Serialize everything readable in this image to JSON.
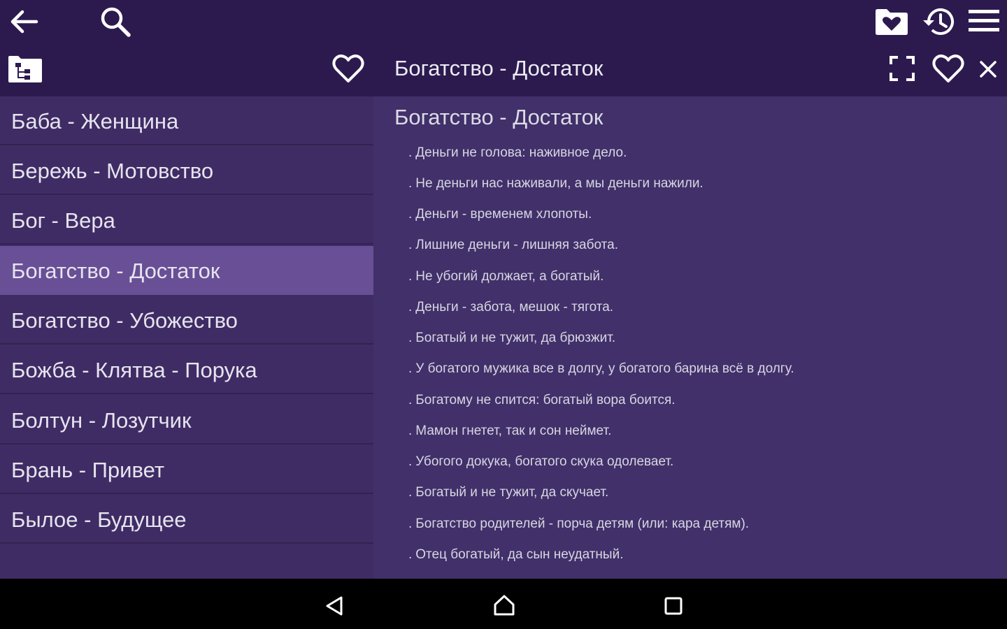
{
  "header": {
    "title": "Богатство - Достаток",
    "icons": [
      "back-arrow-icon",
      "search-icon",
      "heart-folder-icon",
      "history-icon",
      "menu-icon",
      "tree-icon",
      "heart-outline-icon",
      "fullscreen-icon",
      "close-icon"
    ]
  },
  "list": {
    "items": [
      {
        "label": "Баба - Женщина",
        "selected": false
      },
      {
        "label": "Бережь - Мотовство",
        "selected": false
      },
      {
        "label": "Бог - Вера",
        "selected": false
      },
      {
        "label": "Богатство - Достаток",
        "selected": true
      },
      {
        "label": "Богатство - Убожество",
        "selected": false
      },
      {
        "label": "Божба - Клятва - Порука",
        "selected": false
      },
      {
        "label": "Болтун - Лозутчик",
        "selected": false
      },
      {
        "label": "Брань - Привет",
        "selected": false
      },
      {
        "label": "Былое - Будущее",
        "selected": false
      }
    ]
  },
  "detail": {
    "heading": "Богатство - Достаток",
    "bullet": ".",
    "proverbs": [
      "Деньги не голова: наживное дело.",
      "Не деньги нас наживали, а мы деньги нажили.",
      "Деньги - временем хлопоты.",
      "Лишние деньги - лишняя забота.",
      "Не убогий должает, а богатый.",
      "Деньги - забота, мешок - тягота.",
      "Богатый и не тужит, да брюзжит.",
      "У богатого мужика все в долгу, у богатого барина всё в долгу.",
      "Богатому не спится: богатый вора боится.",
      "Мамон гнетет, так и сон неймет.",
      "Убогого докука, богатого скука одолевает.",
      "Богатый и не тужит, да скучает.",
      "Богатство родителей - порча детям (или: кара детям).",
      "Отец богатый, да сын неудатный."
    ]
  },
  "navbar": {
    "icons": [
      "nav-back-icon",
      "nav-home-icon",
      "nav-recents-icon"
    ]
  },
  "colors": {
    "topbar": "#2c1a4f",
    "list_background": "#3f2c65",
    "selected": "#684f96",
    "detail_background": "#41306a",
    "text": "#ececf4"
  }
}
